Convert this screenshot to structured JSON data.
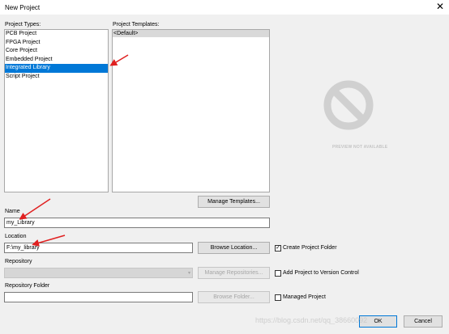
{
  "window": {
    "title": "New Project"
  },
  "project_types": {
    "label": "Project Types:",
    "items": [
      "PCB Project",
      "FPGA Project",
      "Core Project",
      "Embedded Project",
      "Integrated Library",
      "Script Project"
    ],
    "selected_index": 4
  },
  "project_templates": {
    "label": "Project Templates:",
    "items": [
      "<Default>"
    ]
  },
  "preview": {
    "caption": "PREVIEW NOT AVAILABLE",
    "icon": "no-symbol-icon"
  },
  "manage_templates_button": "Manage Templates...",
  "name": {
    "label": "Name",
    "value": "my_Library"
  },
  "location": {
    "label": "Location",
    "value": "F:\\my_library",
    "browse_button": "Browse Location..."
  },
  "create_project_folder": {
    "label": "Create Project Folder",
    "checked": true
  },
  "repository": {
    "label": "Repository",
    "value": "",
    "manage_button": "Manage Repositories...",
    "add_to_vc_label": "Add Project to Version Control",
    "add_to_vc_checked": false
  },
  "repository_folder": {
    "label": "Repository Folder",
    "value": "",
    "browse_button": "Browse Folder...",
    "managed_project_label": "Managed Project",
    "managed_project_checked": false
  },
  "footer": {
    "ok_button": "OK",
    "cancel_button": "Cancel"
  },
  "watermark": "https://blog.csdn.net/qq_38660092",
  "colors": {
    "selection": "#0078d7",
    "annotation_arrow": "#e02020"
  }
}
